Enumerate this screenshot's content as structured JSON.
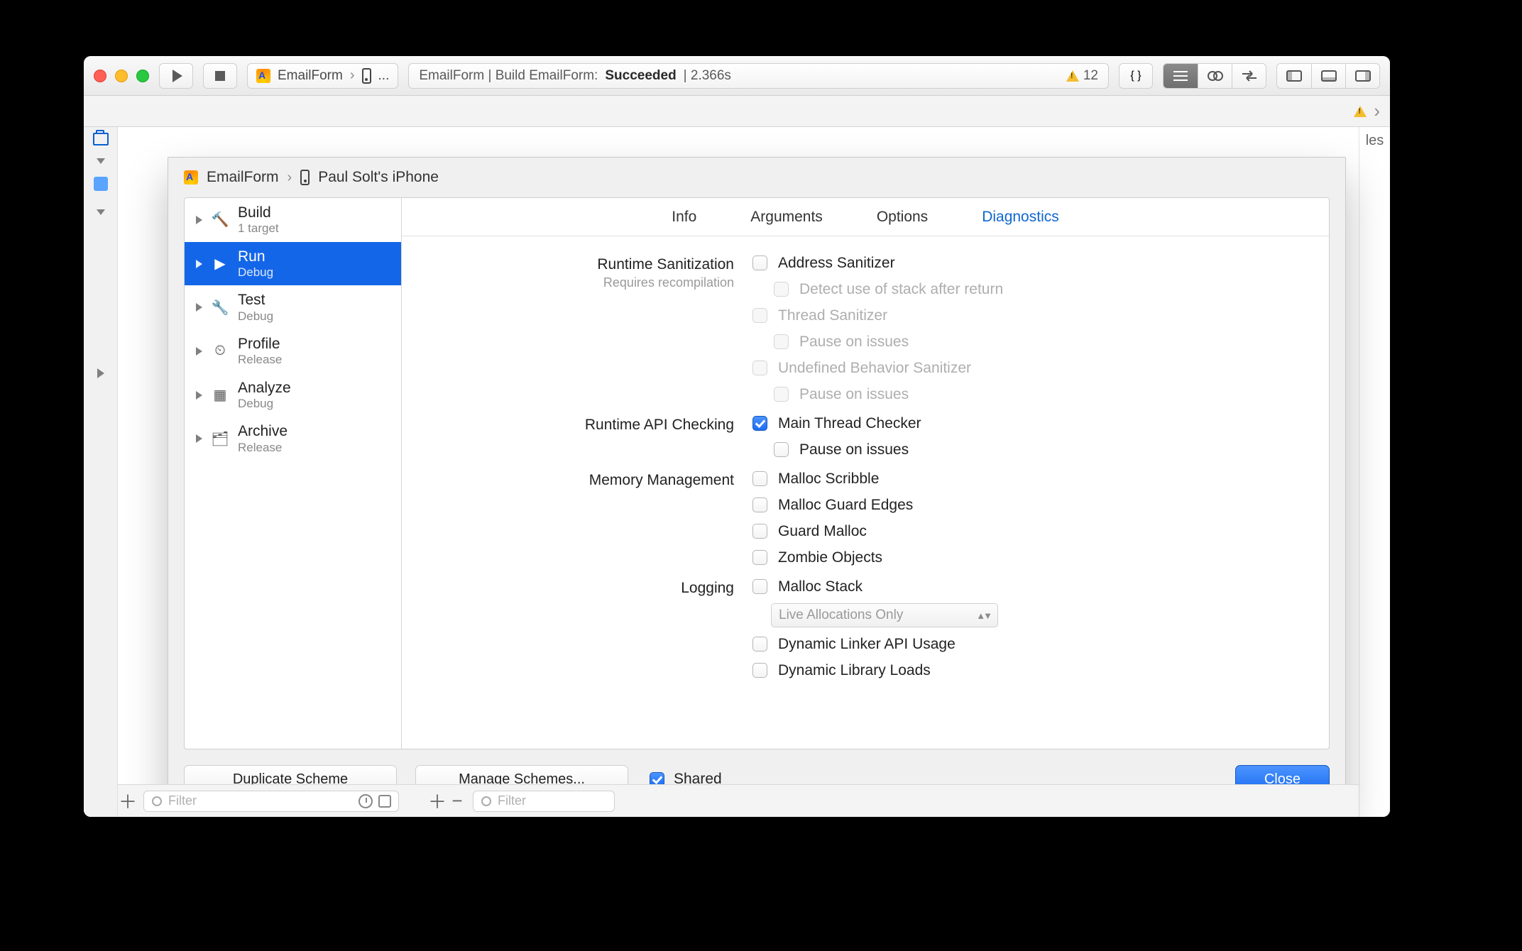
{
  "toolbar": {
    "scheme": "EmailForm",
    "device_ellipsis": "...",
    "status_prefix": "EmailForm | Build EmailForm: ",
    "status_result": "Succeeded",
    "status_time": " | 2.366s",
    "warning_count": "12"
  },
  "tabstrip": {
    "trailing": "les"
  },
  "sheet": {
    "crumb_scheme": "EmailForm",
    "crumb_device": "Paul Solt's iPhone",
    "actions": [
      {
        "title": "Build",
        "sub": "1 target",
        "icon": "hammer"
      },
      {
        "title": "Run",
        "sub": "Debug",
        "icon": "play"
      },
      {
        "title": "Test",
        "sub": "Debug",
        "icon": "wrench"
      },
      {
        "title": "Profile",
        "sub": "Release",
        "icon": "gauge"
      },
      {
        "title": "Analyze",
        "sub": "Debug",
        "icon": "analyze"
      },
      {
        "title": "Archive",
        "sub": "Release",
        "icon": "archive"
      }
    ],
    "tabs": {
      "info": "Info",
      "arguments": "Arguments",
      "options": "Options",
      "diagnostics": "Diagnostics"
    },
    "sections": {
      "runtime_sanitization": {
        "h": "Runtime Sanitization",
        "hint": "Requires recompilation"
      },
      "runtime_api": {
        "h": "Runtime API Checking"
      },
      "memory": {
        "h": "Memory Management"
      },
      "logging": {
        "h": "Logging"
      }
    },
    "opts": {
      "address_sanitizer": "Address Sanitizer",
      "detect_stack": "Detect use of stack after return",
      "thread_sanitizer": "Thread Sanitizer",
      "pause_thread": "Pause on issues",
      "ub_sanitizer": "Undefined Behavior Sanitizer",
      "pause_ub": "Pause on issues",
      "main_thread_checker": "Main Thread Checker",
      "pause_mtc": "Pause on issues",
      "malloc_scribble": "Malloc Scribble",
      "malloc_guard": "Malloc Guard Edges",
      "guard_malloc": "Guard Malloc",
      "zombie": "Zombie Objects",
      "malloc_stack": "Malloc Stack",
      "live_alloc": "Live Allocations Only",
      "dyn_linker": "Dynamic Linker API Usage",
      "dyn_lib": "Dynamic Library Loads"
    },
    "bottom": {
      "duplicate": "Duplicate Scheme",
      "manage": "Manage Schemes...",
      "shared": "Shared",
      "close": "Close"
    }
  },
  "bottombar": {
    "filter": "Filter"
  }
}
